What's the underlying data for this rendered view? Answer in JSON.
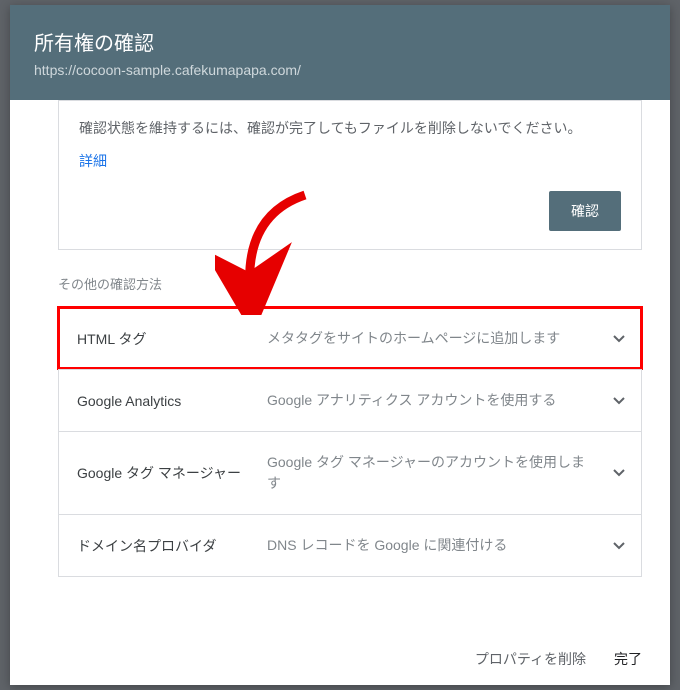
{
  "header": {
    "title": "所有権の確認",
    "subtitle": "https://cocoon-sample.cafekumapapa.com/"
  },
  "info": {
    "text": "確認状態を維持するには、確認が完了してもファイルを削除しないでください。",
    "link": "詳細",
    "confirm_label": "確認"
  },
  "section_label": "その他の確認方法",
  "methods": [
    {
      "name": "HTML タグ",
      "desc": "メタタグをサイトのホームページに追加します"
    },
    {
      "name": "Google Analytics",
      "desc": "Google アナリティクス アカウントを使用する"
    },
    {
      "name": "Google タグ マネージャー",
      "desc": "Google タグ マネージャーのアカウントを使用します"
    },
    {
      "name": "ドメイン名プロバイダ",
      "desc": "DNS レコードを Google に関連付ける"
    }
  ],
  "footer": {
    "delete_label": "プロパティを削除",
    "done_label": "完了"
  }
}
